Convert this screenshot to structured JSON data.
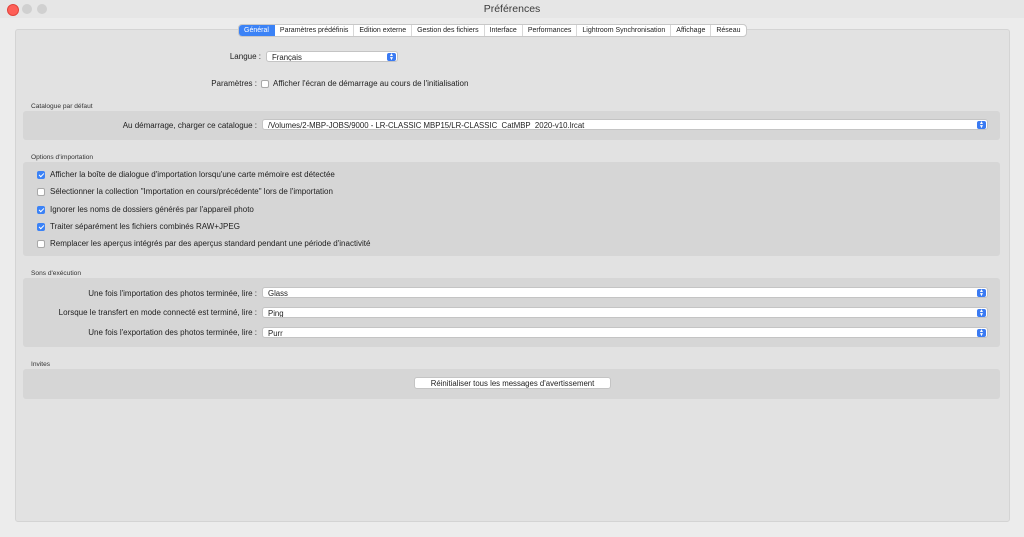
{
  "window": {
    "title": "Préférences"
  },
  "tabs": [
    "Général",
    "Paramètres prédéfinis",
    "Edition externe",
    "Gestion des fichiers",
    "Interface",
    "Performances",
    "Lightroom Synchronisation",
    "Affichage",
    "Réseau"
  ],
  "general": {
    "language_label": "Langue :",
    "language_value": "Français",
    "params_label": "Paramètres :",
    "splash_checkbox": "Afficher l'écran de démarrage au cours de l'initialisation"
  },
  "catalog": {
    "section_title": "Catalogue par défaut",
    "label": "Au démarrage, charger ce catalogue :",
    "value": "/Volumes/2-MBP-JOBS/9000 - LR-CLASSIC MBP15/LR-CLASSIC_CatMBP_2020-v10.lrcat"
  },
  "import": {
    "section_title": "Options d'importation",
    "options": [
      {
        "label": "Afficher la boîte de dialogue d'importation lorsqu'une carte mémoire est détectée",
        "checked": true
      },
      {
        "label": "Sélectionner la collection \"Importation en cours/précédente\" lors de l'importation",
        "checked": false
      },
      {
        "label": "Ignorer les noms de dossiers générés par l'appareil photo",
        "checked": true
      },
      {
        "label": "Traiter séparément les fichiers combinés RAW+JPEG",
        "checked": true
      },
      {
        "label": "Remplacer les aperçus intégrés par des aperçus standard pendant une période d'inactivité",
        "checked": false
      }
    ]
  },
  "sounds": {
    "section_title": "Sons d'exécution",
    "rows": [
      {
        "label": "Une fois l'importation des photos terminée, lire :",
        "value": "Glass"
      },
      {
        "label": "Lorsque le transfert en mode connecté est terminé, lire :",
        "value": "Ping"
      },
      {
        "label": "Une fois l'exportation des photos terminée, lire :",
        "value": "Purr"
      }
    ]
  },
  "prompts": {
    "section_title": "Invites",
    "reset_button": "Réinitialiser tous les messages d'avertissement"
  },
  "colors": {
    "accent": "#3b82f6",
    "close": "#fe5f57"
  }
}
